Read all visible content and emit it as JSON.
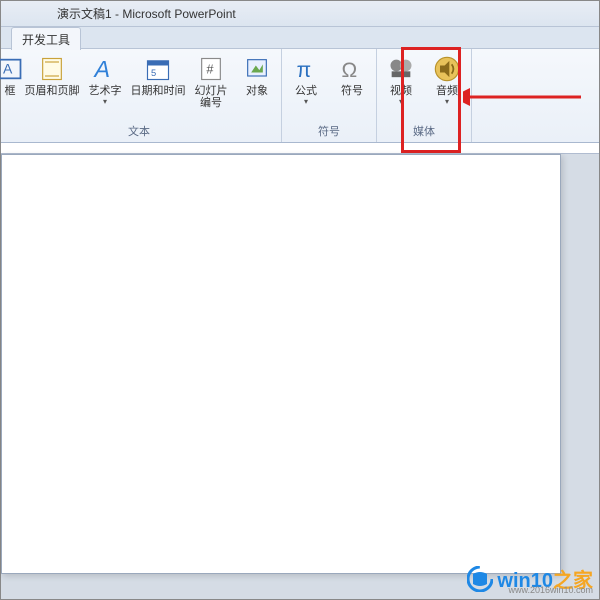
{
  "title": "演示文稿1 - Microsoft PowerPoint",
  "tab": {
    "label": "开发工具"
  },
  "groups": {
    "text": {
      "label": "文本",
      "items": [
        {
          "label": "框"
        },
        {
          "label": "页眉和页脚"
        },
        {
          "label": "艺术字"
        },
        {
          "label": "日期和时间"
        },
        {
          "label": "幻灯片\n编号"
        },
        {
          "label": "对象"
        }
      ]
    },
    "symbols": {
      "label": "符号",
      "items": [
        {
          "label": "公式"
        },
        {
          "label": "符号"
        }
      ]
    },
    "media": {
      "label": "媒体",
      "items": [
        {
          "label": "视频"
        },
        {
          "label": "音频"
        }
      ]
    }
  },
  "watermark": {
    "brand_prefix": "win10",
    "brand_suffix": "之家",
    "url": "www.2016win10.com"
  }
}
